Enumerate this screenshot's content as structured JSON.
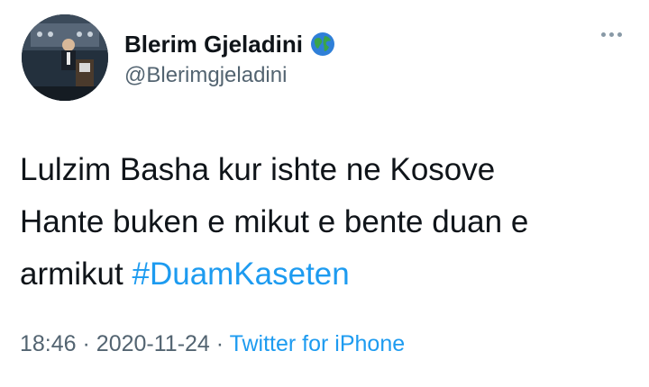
{
  "author": {
    "display_name": "Blerim Gjeladini",
    "handle": "@Blerimgjeladini",
    "badge_icon": "globe-icon"
  },
  "tweet": {
    "lines": [
      "Lulzim Basha kur ishte ne Kosove",
      "Hante buken e mikut e bente duan e",
      "armikut"
    ],
    "hashtag": "#DuamKaseten"
  },
  "meta": {
    "time": "18:46",
    "separator": "·",
    "date": "2020-11-24",
    "source": "Twitter for iPhone"
  },
  "colors": {
    "link": "#1d9bf0",
    "secondary_text": "#536471",
    "primary_text": "#0f1419"
  }
}
